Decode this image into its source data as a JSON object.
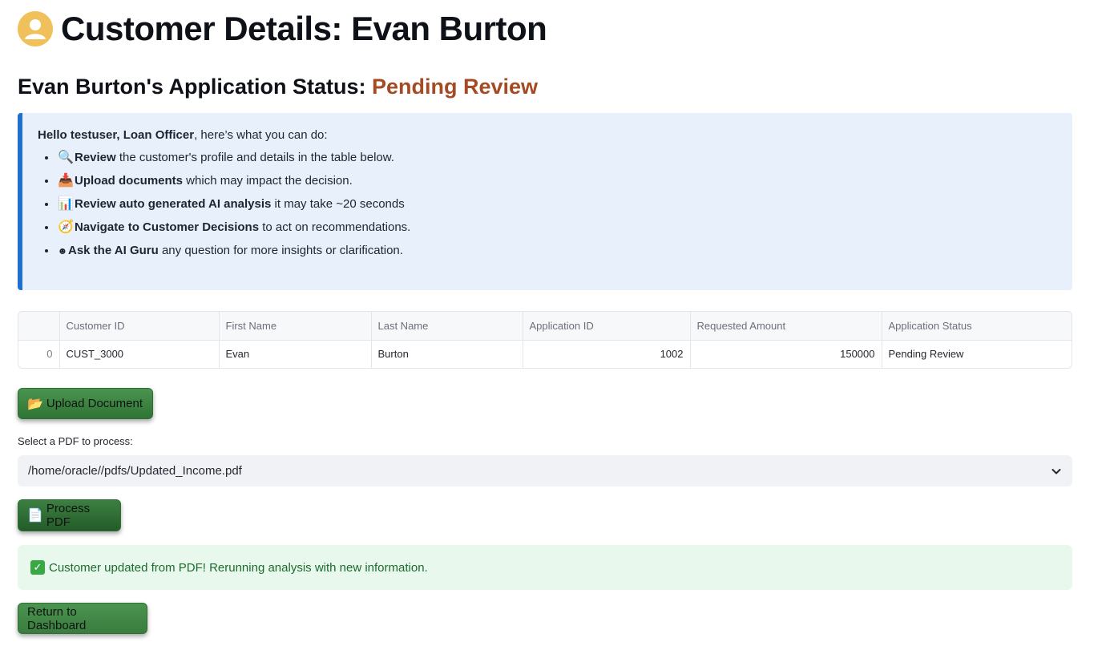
{
  "header": {
    "icon": "user-avatar-icon",
    "title": "Customer Details: Evan Burton"
  },
  "status": {
    "prefix": "Evan Burton's Application Status: ",
    "value": "Pending Review",
    "value_color": "#a54a22"
  },
  "info": {
    "intro_bold": "Hello testuser, Loan Officer",
    "intro_rest": ", here’s what you can do:",
    "items": [
      {
        "icon": "magnifier-icon",
        "glyph": "🔍",
        "bold": "Review",
        "rest": " the customer's profile and details in the table below."
      },
      {
        "icon": "inbox-tray-icon",
        "glyph": "📥",
        "bold": "Upload documents",
        "rest": " which may impact the decision."
      },
      {
        "icon": "bar-chart-icon",
        "glyph": "📊",
        "bold": "Review auto generated AI analysis",
        "rest": " it may take ~20 seconds"
      },
      {
        "icon": "compass-icon",
        "glyph": "🧭",
        "bold": "Navigate to Customer Decisions",
        "rest": " to act on recommendations."
      },
      {
        "icon": "guru-icon",
        "glyph": "☻",
        "bold": "Ask the AI Guru",
        "rest": " any question for more insights or clarification."
      }
    ]
  },
  "table": {
    "columns": [
      "",
      "Customer ID",
      "First Name",
      "Last Name",
      "Application ID",
      "Requested Amount",
      "Application Status"
    ],
    "rows": [
      [
        "0",
        "CUST_3000",
        "Evan",
        "Burton",
        "1002",
        "150000",
        "Pending Review"
      ]
    ]
  },
  "upload": {
    "icon": "folder-icon",
    "label": "Upload Document"
  },
  "pdf_select": {
    "label": "Select a PDF to process:",
    "value": "/home/oracle//pdfs/Updated_Income.pdf"
  },
  "process": {
    "icon": "page-icon",
    "label": "Process PDF"
  },
  "success": {
    "icon": "check-mark-icon",
    "message": "Customer updated from PDF! Rerunning analysis with new information."
  },
  "return_button": {
    "label": "Return to Dashboard"
  },
  "colors": {
    "accent_blue": "#1f6fd1",
    "button_green": "#3f8a44",
    "success_text": "#1b6b2f"
  }
}
